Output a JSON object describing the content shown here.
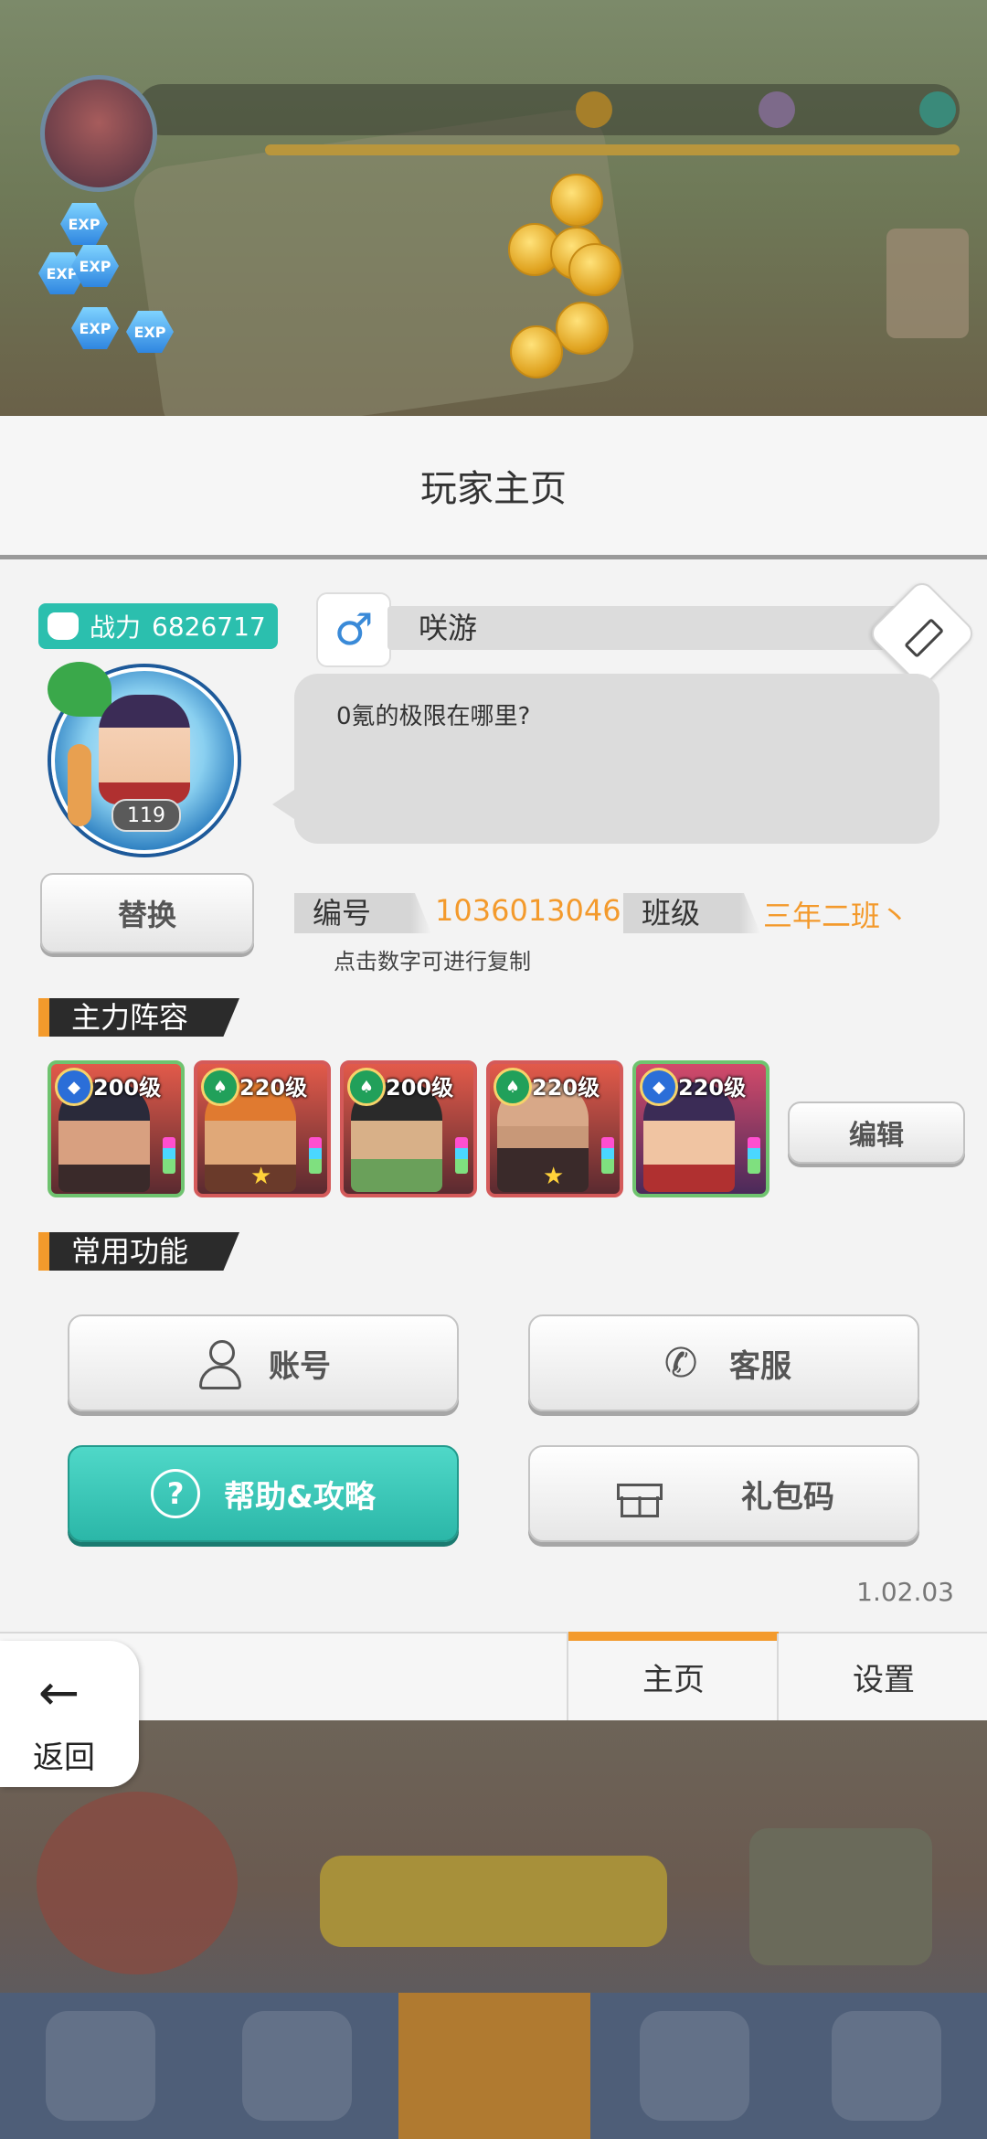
{
  "panel": {
    "title": "玩家主页"
  },
  "profile": {
    "power_label": "战力",
    "power_value": "6826717",
    "gender_symbol": "♂",
    "name": "咲游",
    "signature": "0氪的极限在哪里?",
    "avatar_level": "119",
    "swap_label": "替换",
    "id_label": "编号",
    "id_value": "1036013046",
    "class_label": "班级",
    "class_value": "三年二班丶",
    "copy_hint": "点击数字可进行复制"
  },
  "lineup": {
    "header": "主力阵容",
    "edit_label": "编辑",
    "heroes": [
      {
        "level": "200级",
        "grade_color": "blue",
        "star": false
      },
      {
        "level": "220级",
        "grade_color": "green",
        "star": true
      },
      {
        "level": "200级",
        "grade_color": "green",
        "star": false
      },
      {
        "level": "220级",
        "grade_color": "green",
        "star": true
      },
      {
        "level": "220级",
        "grade_color": "blue",
        "star": false
      }
    ]
  },
  "functions": {
    "header": "常用功能",
    "account": "账号",
    "service": "客服",
    "help": "帮助&攻略",
    "gift_code": "礼包码"
  },
  "version": "1.02.03",
  "tabs": {
    "home": "主页",
    "settings": "设置"
  },
  "back": {
    "label": "返回"
  },
  "background": {
    "exp_badge": "EXP"
  },
  "colors": {
    "accent_orange": "#f39a2c",
    "teal": "#2bbfae"
  }
}
